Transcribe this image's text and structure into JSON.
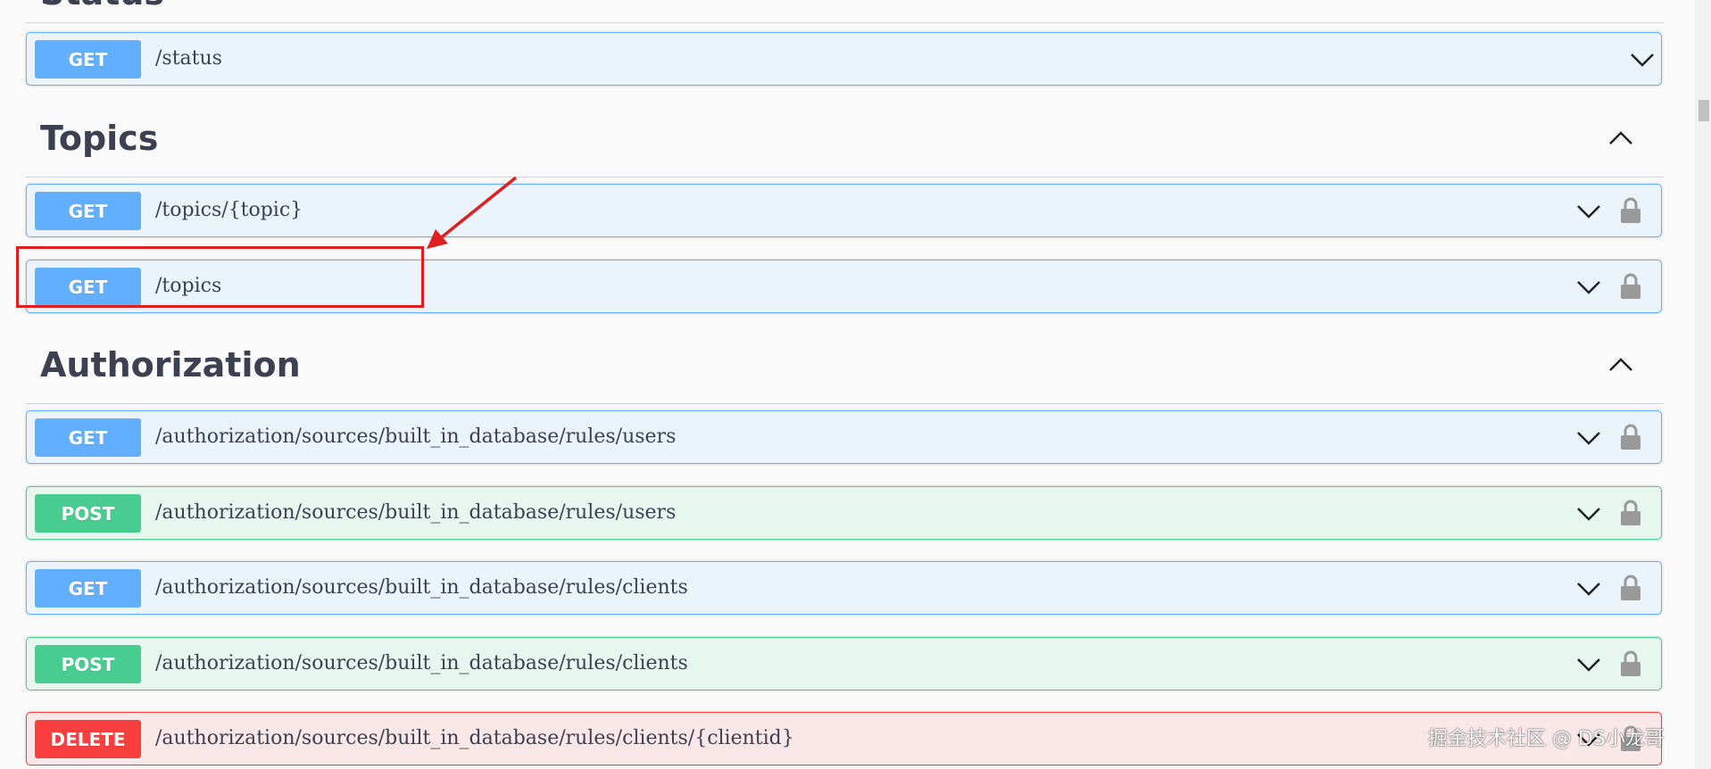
{
  "partial_section": {
    "title": "Status"
  },
  "operations_status": [
    {
      "method": "GET",
      "path": "/status",
      "locked": false
    }
  ],
  "sections": [
    {
      "title": "Topics",
      "operations": [
        {
          "method": "GET",
          "path": "/topics/{topic}",
          "locked": true
        },
        {
          "method": "GET",
          "path": "/topics",
          "locked": true
        }
      ]
    },
    {
      "title": "Authorization",
      "operations": [
        {
          "method": "GET",
          "path": "/authorization/sources/built_in_database/rules/users",
          "locked": true
        },
        {
          "method": "POST",
          "path": "/authorization/sources/built_in_database/rules/users",
          "locked": true
        },
        {
          "method": "GET",
          "path": "/authorization/sources/built_in_database/rules/clients",
          "locked": true
        },
        {
          "method": "POST",
          "path": "/authorization/sources/built_in_database/rules/clients",
          "locked": true
        },
        {
          "method": "DELETE",
          "path": "/authorization/sources/built_in_database/rules/clients/{clientid}",
          "locked": true
        }
      ]
    }
  ],
  "watermark": "掘金技术社区 @ DS小龙哥",
  "colors": {
    "get": "#61affe",
    "post": "#49cc90",
    "delete": "#f93e3e",
    "annotation": "#e02020"
  },
  "icons": {
    "expand": "chevron-down-icon",
    "collapse": "chevron-up-icon",
    "lock": "lock-icon"
  }
}
